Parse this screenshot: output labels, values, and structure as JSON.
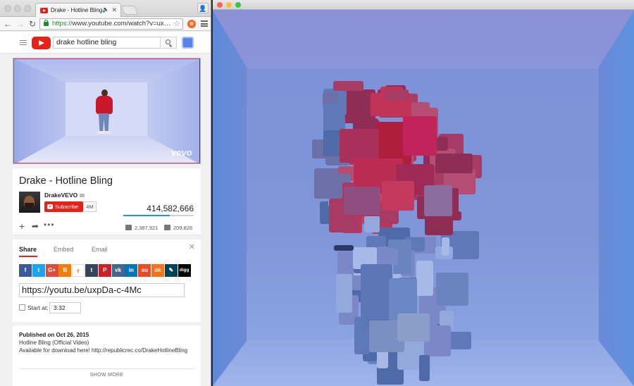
{
  "browser": {
    "tab_title": "Drake - Hotline Bling",
    "speaker_glyph": "🔈",
    "close_glyph": "✕",
    "url_scheme": "https://",
    "url_rest": "www.youtube.com/watch?v=ux…",
    "profile_glyph": "👤"
  },
  "youtube": {
    "search_value": "drake hotline bling",
    "video": {
      "watermark": "vevo",
      "title": "Drake - Hotline Bling",
      "channel": "DrakeVEVO",
      "subscribe_label": "Subscribe",
      "subscriber_count": "4M",
      "views": "414,582,666",
      "view_bar_ratio": 0.66,
      "likes": "2,387,921",
      "dislikes": "209,826",
      "add_glyph": "+",
      "share_glyph": "➦",
      "more_glyph": "•••"
    },
    "share": {
      "tabs": [
        "Share",
        "Embed",
        "Email"
      ],
      "close_glyph": "✕",
      "social": [
        {
          "name": "facebook",
          "label": "f",
          "color": "#3b5998"
        },
        {
          "name": "twitter",
          "label": "t",
          "color": "#1da1f2"
        },
        {
          "name": "google-plus",
          "label": "G+",
          "color": "#dd4b39"
        },
        {
          "name": "blogger",
          "label": "B",
          "color": "#f57d00"
        },
        {
          "name": "reddit",
          "label": "r",
          "color": "#ffffff",
          "text_color": "#ff4500"
        },
        {
          "name": "tumblr",
          "label": "t",
          "color": "#35465c"
        },
        {
          "name": "pinterest",
          "label": "P",
          "color": "#cb2027"
        },
        {
          "name": "vkontakte",
          "label": "vk",
          "color": "#45668e"
        },
        {
          "name": "linkedin",
          "label": "in",
          "color": "#0077b5"
        },
        {
          "name": "stumbleupon",
          "label": "su",
          "color": "#eb4924"
        },
        {
          "name": "odnoklassniki",
          "label": "ok",
          "color": "#f4731c"
        },
        {
          "name": "livejournal",
          "label": "✎",
          "color": "#004359"
        },
        {
          "name": "digg",
          "label": "digg",
          "color": "#000000"
        }
      ],
      "url": "https://youtu.be/uxpDa-c-4Mc",
      "start_at_label": "Start at:",
      "start_at_value": "3:32"
    },
    "description": {
      "published": "Published on Oct 26, 2015",
      "line1": "Hotline Bling (Official Video)",
      "line2": "Available for download here! http://republicrec.co/DrakeHotlineBling",
      "show_more": "SHOW MORE"
    }
  },
  "colors": {
    "youtube_red": "#e62117",
    "link_blue": "#2793e6",
    "scene_wall": "#7f96d8"
  }
}
